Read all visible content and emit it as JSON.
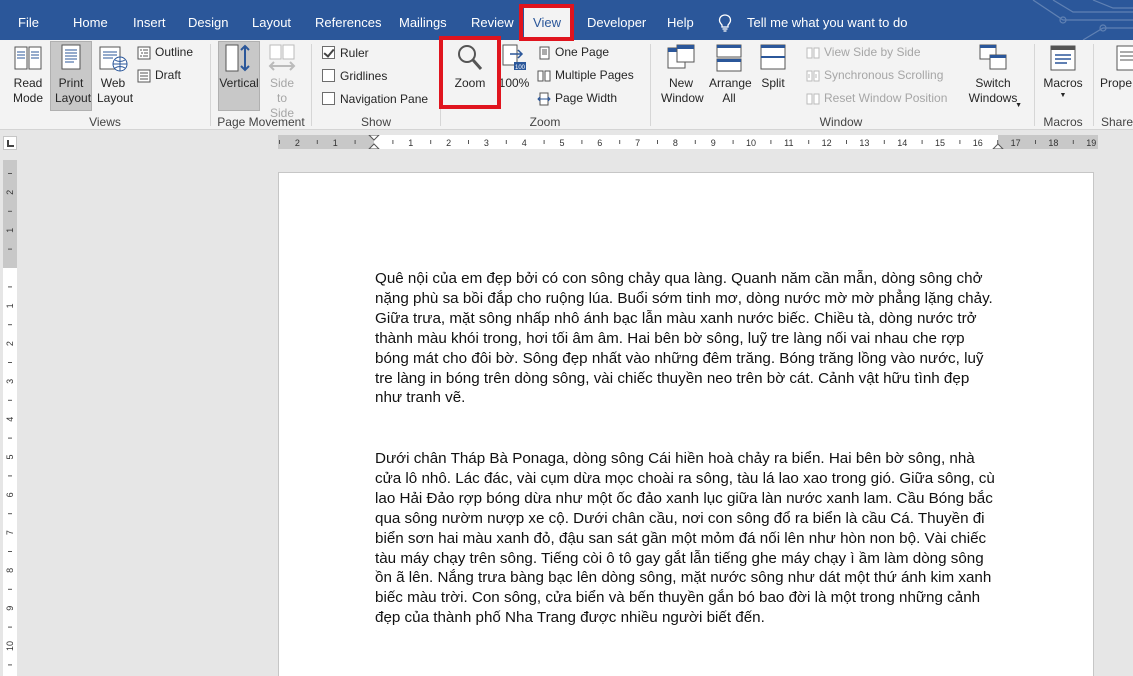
{
  "tabs": [
    "File",
    "Home",
    "Insert",
    "Design",
    "Layout",
    "References",
    "Mailings",
    "Review",
    "View",
    "Developer",
    "Help"
  ],
  "active_tab": "View",
  "tell_me": "Tell me what you want to do",
  "groups": {
    "views": {
      "label": "Views",
      "read_mode": "Read Mode",
      "print_layout": "Print Layout",
      "web_layout": "Web Layout",
      "outline": "Outline",
      "draft": "Draft"
    },
    "page_movement": {
      "label": "Page Movement",
      "vertical": "Vertical",
      "side_to_side": "Side to Side"
    },
    "show": {
      "label": "Show",
      "ruler": "Ruler",
      "ruler_checked": true,
      "gridlines": "Gridlines",
      "gridlines_checked": false,
      "navigation_pane": "Navigation Pane",
      "navigation_checked": false
    },
    "zoom": {
      "label": "Zoom",
      "zoom": "Zoom",
      "hundred": "100%",
      "one_page": "One Page",
      "multiple_pages": "Multiple Pages",
      "page_width": "Page Width"
    },
    "window": {
      "label": "Window",
      "new_window": "New Window",
      "arrange_all": "Arrange All",
      "split": "Split",
      "view_side_by_side": "View Side by Side",
      "synchronous_scrolling": "Synchronous Scrolling",
      "reset_window_position": "Reset Window Position",
      "switch_windows": "Switch Windows"
    },
    "macros": {
      "label": "Macros",
      "macros": "Macros"
    },
    "sharepoint": {
      "label": "ShareP",
      "properties": "Prope"
    }
  },
  "ruler_labels": [
    "2",
    "1",
    "1",
    "2",
    "3",
    "4",
    "5",
    "6",
    "7",
    "8",
    "9",
    "10",
    "11",
    "12",
    "13",
    "14",
    "15",
    "16",
    "17",
    "18",
    "19"
  ],
  "vruler_labels": [
    "2",
    "1",
    "1",
    "2",
    "3",
    "4",
    "5",
    "6",
    "7",
    "8",
    "9",
    "10"
  ],
  "document": {
    "paragraph1": "Quê nội của em đẹp bởi có con sông chảy qua làng. Quanh năm cần mẫn, dòng sông chở nặng phù sa bồi đắp cho ruộng lúa. Buổi sớm tinh mơ, dòng nước mờ mờ phẳng lặng chảy. Giữa trưa, mặt sông nhấp nhô ánh bạc lẫn màu xanh nước biếc. Chiều tà, dòng nước trở thành màu khói trong, hơi tối âm âm. Hai bên bờ sông, luỹ tre làng nối vai nhau che rợp bóng mát cho đôi bờ. Sông đẹp nhất vào những đêm trăng. Bóng trăng lồng vào nước, luỹ tre làng in bóng trên dòng sông, vài chiếc thuyền neo trên bờ cát. Cảnh vật hữu tình đẹp như tranh vẽ.",
    "paragraph2": "Dưới chân Tháp Bà Ponaga, dòng sông Cái hiền hoà chảy ra biển. Hai bên bờ sông, nhà cửa lô nhô. Lác đác, vài cụm dừa mọc choài ra sông, tàu lá lao xao trong gió. Giữa sông, cù lao Hải Đảo rợp bóng dừa như một ốc đảo xanh lục giữa làn nước xanh lam. Cầu Bóng bắc qua sông nườm nượp xe cộ. Dưới chân cầu, nơi con sông đổ ra biển là cầu Cá. Thuyền đi biển sơn hai màu xanh đỏ, đậu san sát gần một mỏm đá nối lên như hòn non bộ. Vài chiếc tàu máy chạy trên sông. Tiếng còi ô tô gay gắt lẫn tiếng ghe máy chạy ì ầm làm dòng sông ồn ã lên. Nắng trưa bàng bạc lên dòng sông, mặt nước sông như dát một thứ ánh kim xanh biếc màu trời. Con sông, cửa biển và bến thuyền gắn bó bao đời là một trong những cảnh đẹp của thành phố Nha Trang được nhiều người biết đến."
  },
  "colors": {
    "title_bar": "#2b579a",
    "ribbon": "#f3f3f3",
    "highlight": "#e0141e"
  }
}
